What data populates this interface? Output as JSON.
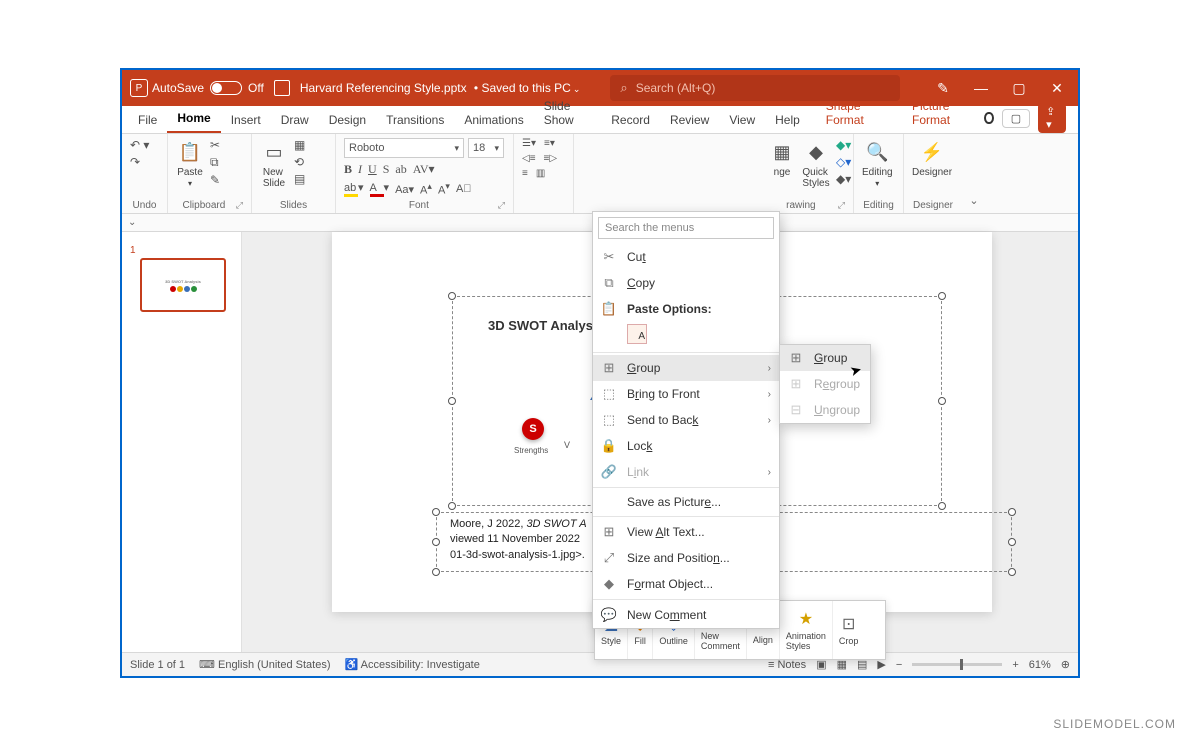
{
  "title_bar": {
    "autosave_label": "AutoSave",
    "autosave_state": "Off",
    "filename": "Harvard Referencing Style.pptx",
    "saved_state": "Saved to this PC"
  },
  "search": {
    "placeholder": "Search (Alt+Q)"
  },
  "tabs": {
    "file": "File",
    "home": "Home",
    "insert": "Insert",
    "draw": "Draw",
    "design": "Design",
    "transitions": "Transitions",
    "animations": "Animations",
    "slideshow": "Slide Show",
    "record": "Record",
    "review": "Review",
    "view": "View",
    "help": "Help",
    "shape_format": "Shape Format",
    "picture_format": "Picture Format"
  },
  "ribbon": {
    "undo": "Undo",
    "clipboard": {
      "paste": "Paste",
      "label": "Clipboard"
    },
    "slides": {
      "new_slide": "New\nSlide",
      "label": "Slides"
    },
    "font": {
      "name": "Roboto",
      "size": "18",
      "label": "Font",
      "aa": "Aa",
      "increase": "A",
      "decrease": "A"
    },
    "drawing": {
      "arrange": "nge",
      "quick": "Quick\nStyles",
      "label": "rawing"
    },
    "editing": {
      "label": "Editing",
      "editing_btn": "Editing"
    },
    "designer": {
      "label": "Designer",
      "btn": "Designer"
    }
  },
  "context_menu": {
    "search": "Search the menus",
    "cut": "Cut",
    "copy": "Copy",
    "paste_options": "Paste Options:",
    "group": "Group",
    "bring_front": "Bring to Front",
    "send_back": "Send to Back",
    "lock": "Lock",
    "link": "Link",
    "save_picture": "Save as Picture...",
    "view_alt": "View Alt Text...",
    "size_pos": "Size and Position...",
    "format_object": "Format Object...",
    "new_comment": "New Comment"
  },
  "sub_menu": {
    "group": "Group",
    "regroup": "Regroup",
    "ungroup": "Ungroup"
  },
  "mini_toolbar": {
    "style": "Style",
    "fill": "Fill",
    "outline": "Outline",
    "new_comment": "New\nComment",
    "align": "Align",
    "animation": "Animation\nStyles",
    "crop": "Crop"
  },
  "slide": {
    "picture_title": "3D SWOT Analysis",
    "s_badge": "S",
    "strengths": "Strengths",
    "w": "V",
    "text1_a": "Moore, J 2022, ",
    "text1_b": "3D SWOT A",
    "text2": "viewed 11 November 2022",
    "text3": "01-3d-swot-analysis-1.jpg>."
  },
  "thumb": {
    "num": "1"
  },
  "status": {
    "slide": "Slide 1 of 1",
    "lang": "English (United States)",
    "access": "Accessibility: Investigate",
    "notes": "Notes",
    "zoom": "61%"
  },
  "watermark": "SLIDEMODEL.COM"
}
